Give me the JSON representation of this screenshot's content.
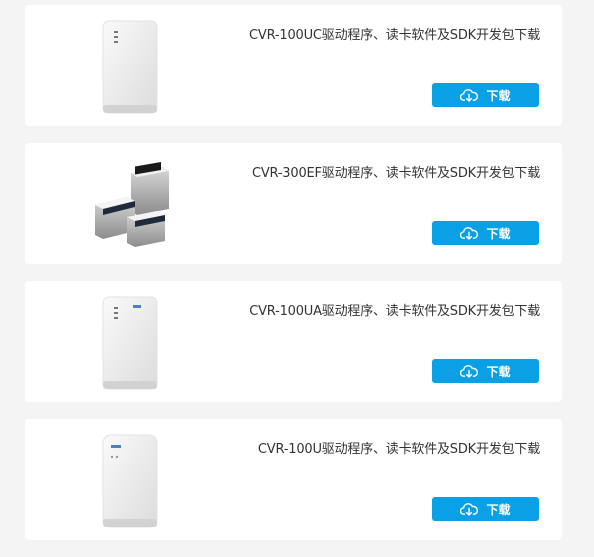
{
  "products": [
    {
      "title": "CVR-100UC驱动程序、读卡软件及SDK开发包下载",
      "button_label": "下载",
      "image": "reader-white-upright"
    },
    {
      "title": "CVR-300EF驱动程序、读卡软件及SDK开发包下载",
      "button_label": "下载",
      "image": "reader-desktop-dual"
    },
    {
      "title": "CVR-100UA驱动程序、读卡软件及SDK开发包下载",
      "button_label": "下载",
      "image": "reader-white-upright"
    },
    {
      "title": "CVR-100U驱动程序、读卡软件及SDK开发包下载",
      "button_label": "下载",
      "image": "reader-white-upright-v2"
    }
  ],
  "colors": {
    "page_bg": "#f4f4f4",
    "card_bg": "#ffffff",
    "button_bg": "#0aa0e6",
    "title_text": "#333333"
  }
}
